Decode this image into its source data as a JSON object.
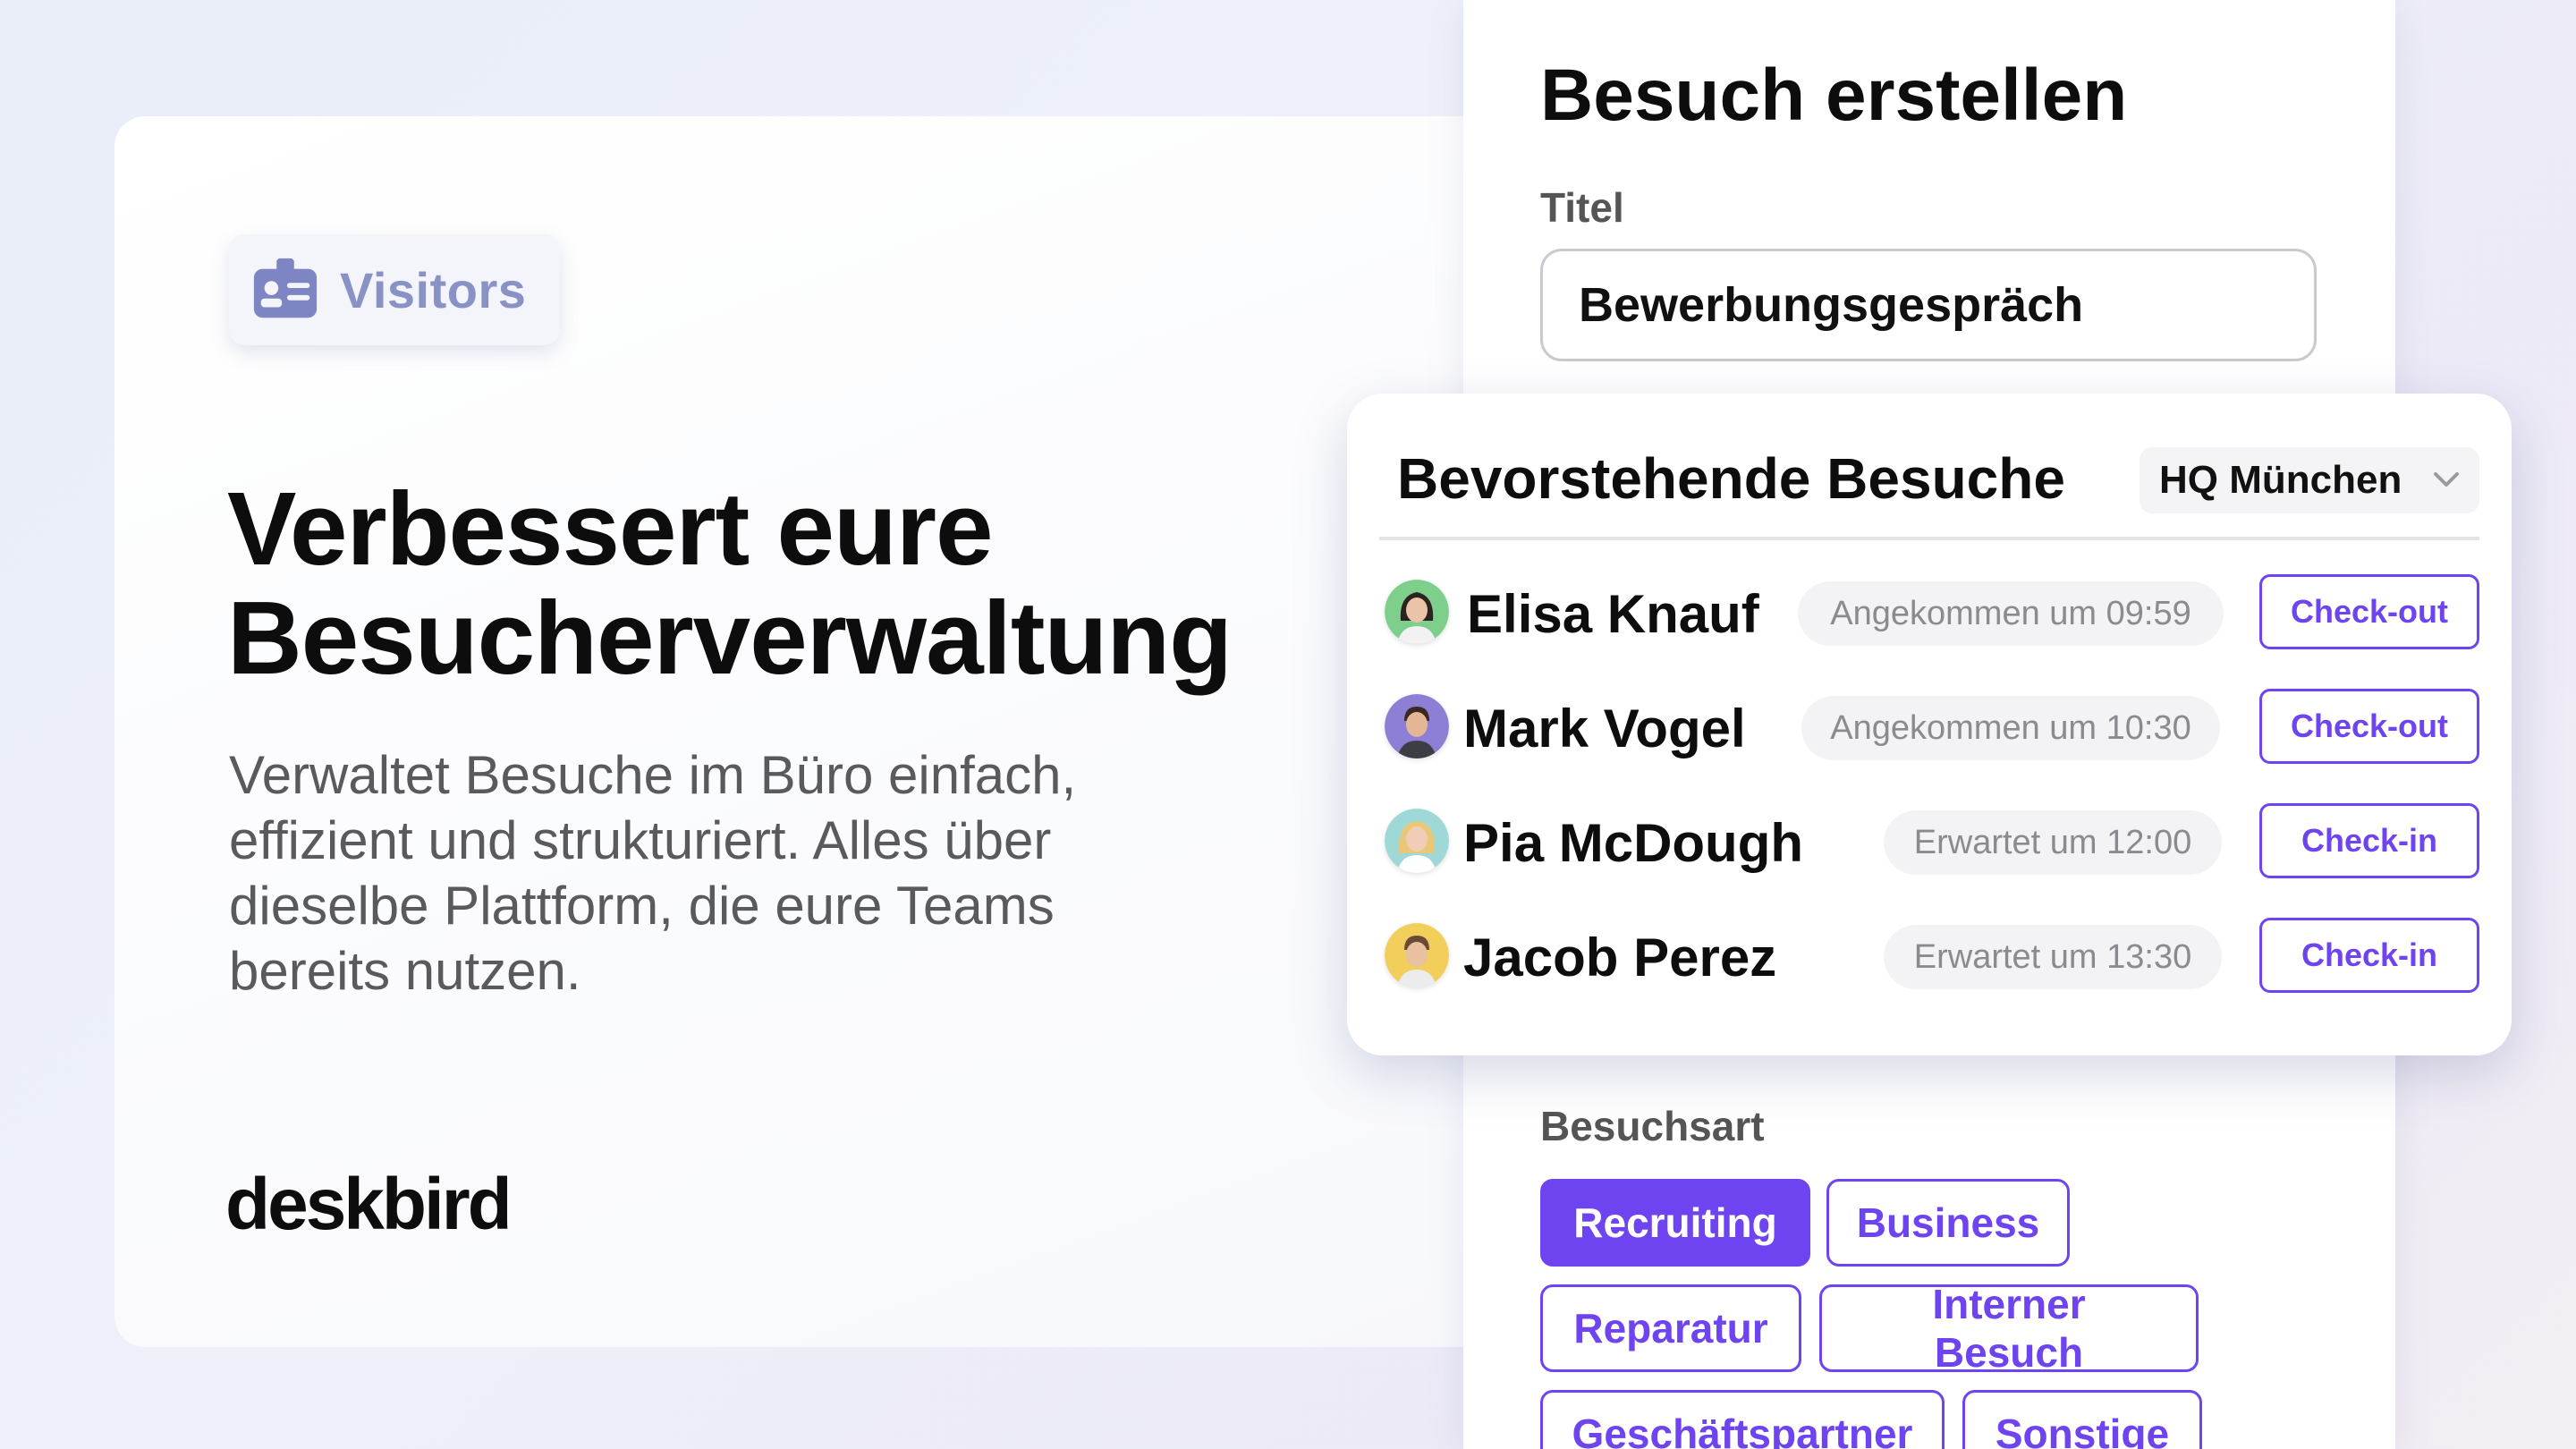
{
  "hero": {
    "badge_label": "Visitors",
    "headline_line1": "Verbessert eure",
    "headline_line2": "Besucherverwaltung",
    "subtext_line1": "Verwaltet Besuche im Büro einfach,",
    "subtext_line2": "effizient und strukturiert. Alles über",
    "subtext_line3": "dieselbe Plattform, die eure Teams",
    "subtext_line4": "bereits nutzen.",
    "brand": "deskbird"
  },
  "form": {
    "title": "Besuch erstellen",
    "title_label": "Titel",
    "title_value": "Bewerbungsgespräch",
    "visit_type_label": "Besuchsart",
    "visit_types": [
      {
        "label": "Recruiting",
        "selected": true
      },
      {
        "label": "Business",
        "selected": false
      },
      {
        "label": "Reparatur",
        "selected": false
      },
      {
        "label": "Interner Besuch",
        "selected": false
      },
      {
        "label": "Geschäftspartner",
        "selected": false
      },
      {
        "label": "Sonstige",
        "selected": false
      }
    ]
  },
  "upcoming": {
    "title": "Bevorstehende Besuche",
    "location": "HQ München",
    "visits": [
      {
        "name": "Elisa Knauf",
        "status": "Angekommen um 09:59",
        "action": "Check-out"
      },
      {
        "name": "Mark Vogel",
        "status": "Angekommen um 10:30",
        "action": "Check-out"
      },
      {
        "name": "Pia McDough",
        "status": "Erwartet um 12:00",
        "action": "Check-in"
      },
      {
        "name": "Jacob Perez",
        "status": "Erwartet um 13:30",
        "action": "Check-in"
      }
    ]
  },
  "colors": {
    "accent": "#6e43f0",
    "badge_text": "#8892c4"
  }
}
